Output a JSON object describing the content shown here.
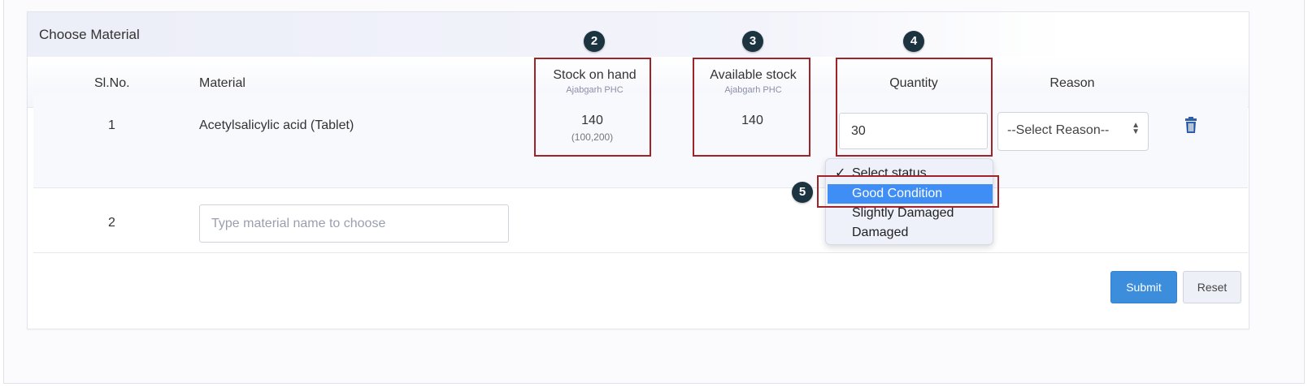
{
  "panel": {
    "title": "Choose Material"
  },
  "table": {
    "headers": {
      "slno": "Sl.No.",
      "material": "Material",
      "stock_on_hand": {
        "label": "Stock on hand",
        "sub": "Ajabgarh PHC"
      },
      "available_stock": {
        "label": "Available stock",
        "sub": "Ajabgarh PHC"
      },
      "quantity": "Quantity",
      "reason": "Reason"
    },
    "rows": [
      {
        "slno": "1",
        "material": "Acetylsalicylic acid (Tablet)",
        "stock_on_hand": "140",
        "stock_range": "(100,200)",
        "available_stock": "140",
        "quantity": "30",
        "reason": "--Select Reason--"
      },
      {
        "slno": "2",
        "material_placeholder": "Type material name to choose"
      }
    ]
  },
  "status_dropdown": {
    "options": [
      "Select status",
      "Good Condition",
      "Slightly Damaged",
      "Damaged"
    ],
    "checked_index": 0,
    "highlighted_index": 1
  },
  "buttons": {
    "submit": "Submit",
    "reset": "Reset"
  },
  "callouts": {
    "stock_on_hand": "2",
    "available_stock": "3",
    "quantity": "4",
    "status": "5"
  },
  "colors": {
    "accent": "#3c8ddc",
    "highlight_option": "#3f8ef5",
    "callout_badge": "#1c3340",
    "callout_box": "#a0232a",
    "delete_icon": "#2f5fa8"
  },
  "icons": {
    "delete": "trash-icon",
    "select": "updown-arrows-icon",
    "check": "check-icon"
  }
}
